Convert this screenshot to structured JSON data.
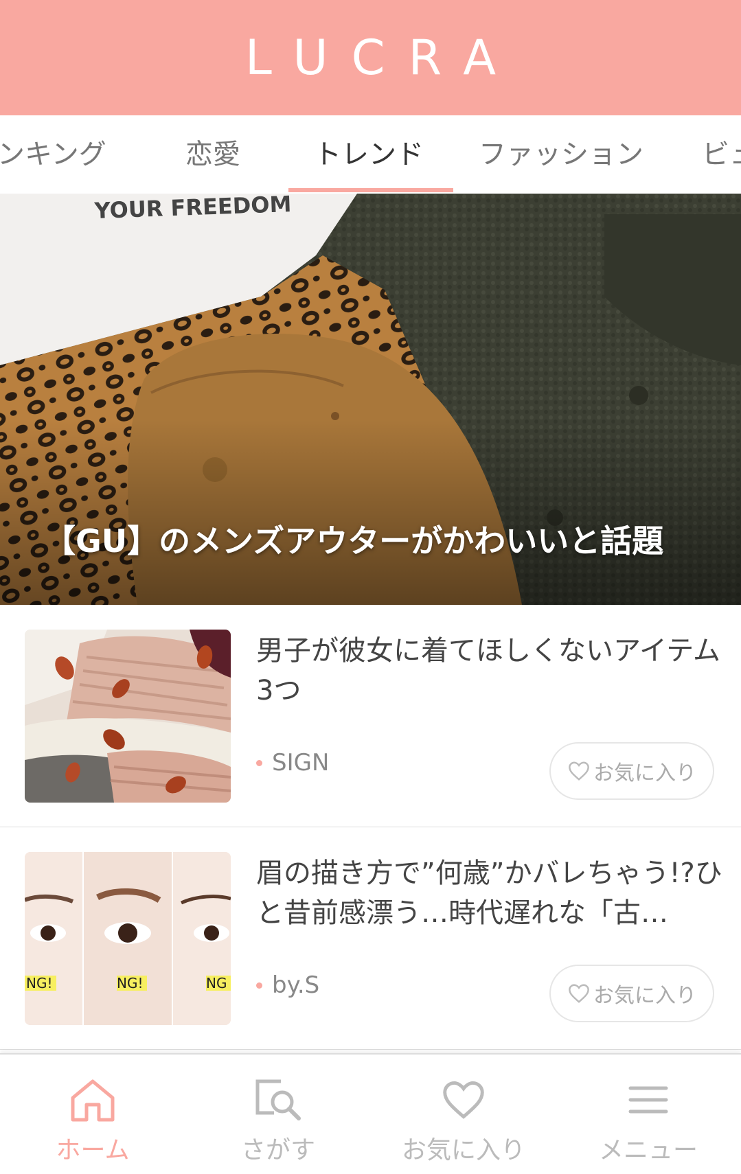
{
  "header": {
    "logo": "LUCRA"
  },
  "tabs": [
    {
      "label": "ンキング"
    },
    {
      "label": "恋愛"
    },
    {
      "label": "トレンド",
      "active": true
    },
    {
      "label": "ファッション"
    },
    {
      "label": "ビュ"
    }
  ],
  "hero": {
    "caption": "【GU】のメンズアウターがかわいいと話題",
    "image_text": "YOUR FREEDOM"
  },
  "articles": [
    {
      "title": "男子が彼女に着てほしくないアイテム3つ",
      "source": "SIGN",
      "favorite_label": "お気に入り"
    },
    {
      "title": "眉の描き方で”何歳”かバレちゃう!?ひと昔前感漂う…時代遅れな「古…",
      "source": "by.S",
      "favorite_label": "お気に入り",
      "thumb_labels": [
        "NG!",
        "NG!",
        "NG"
      ]
    }
  ],
  "bottom_nav": [
    {
      "label": "ホーム",
      "icon": "home-icon",
      "active": true
    },
    {
      "label": "さがす",
      "icon": "search-icon"
    },
    {
      "label": "お気に入り",
      "icon": "heart-icon"
    },
    {
      "label": "メニュー",
      "icon": "menu-icon"
    }
  ],
  "colors": {
    "accent": "#f9a8a0",
    "text": "#444444",
    "muted": "#aaaaaa"
  }
}
